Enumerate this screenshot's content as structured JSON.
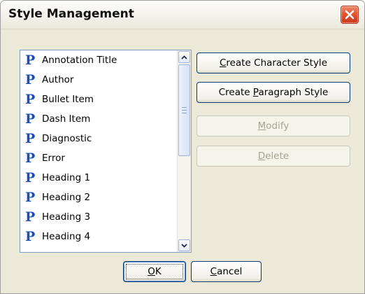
{
  "window": {
    "title": "Style Management"
  },
  "style_list": {
    "icon_glyph": "P",
    "icon_name": "paragraph-style-icon",
    "items": [
      "Annotation Title",
      "Author",
      "Bullet Item",
      "Dash Item",
      "Diagnostic",
      "Error",
      "Heading 1",
      "Heading 2",
      "Heading 3",
      "Heading 4"
    ]
  },
  "buttons": {
    "create_character_style": {
      "mnemonic": "C",
      "rest": "reate Character Style"
    },
    "create_paragraph_style": {
      "pre": "Create ",
      "mnemonic": "P",
      "rest": "aragraph Style"
    },
    "modify": {
      "mnemonic": "M",
      "rest": "odify"
    },
    "delete": {
      "mnemonic": "D",
      "rest": "elete"
    },
    "ok": {
      "mnemonic": "O",
      "rest": "K"
    },
    "cancel": {
      "mnemonic": "C",
      "rest": "ancel"
    }
  },
  "colors": {
    "dialog_bg": "#ece9d8",
    "icon_blue": "#1c50b8",
    "close_red": "#e2502d"
  }
}
